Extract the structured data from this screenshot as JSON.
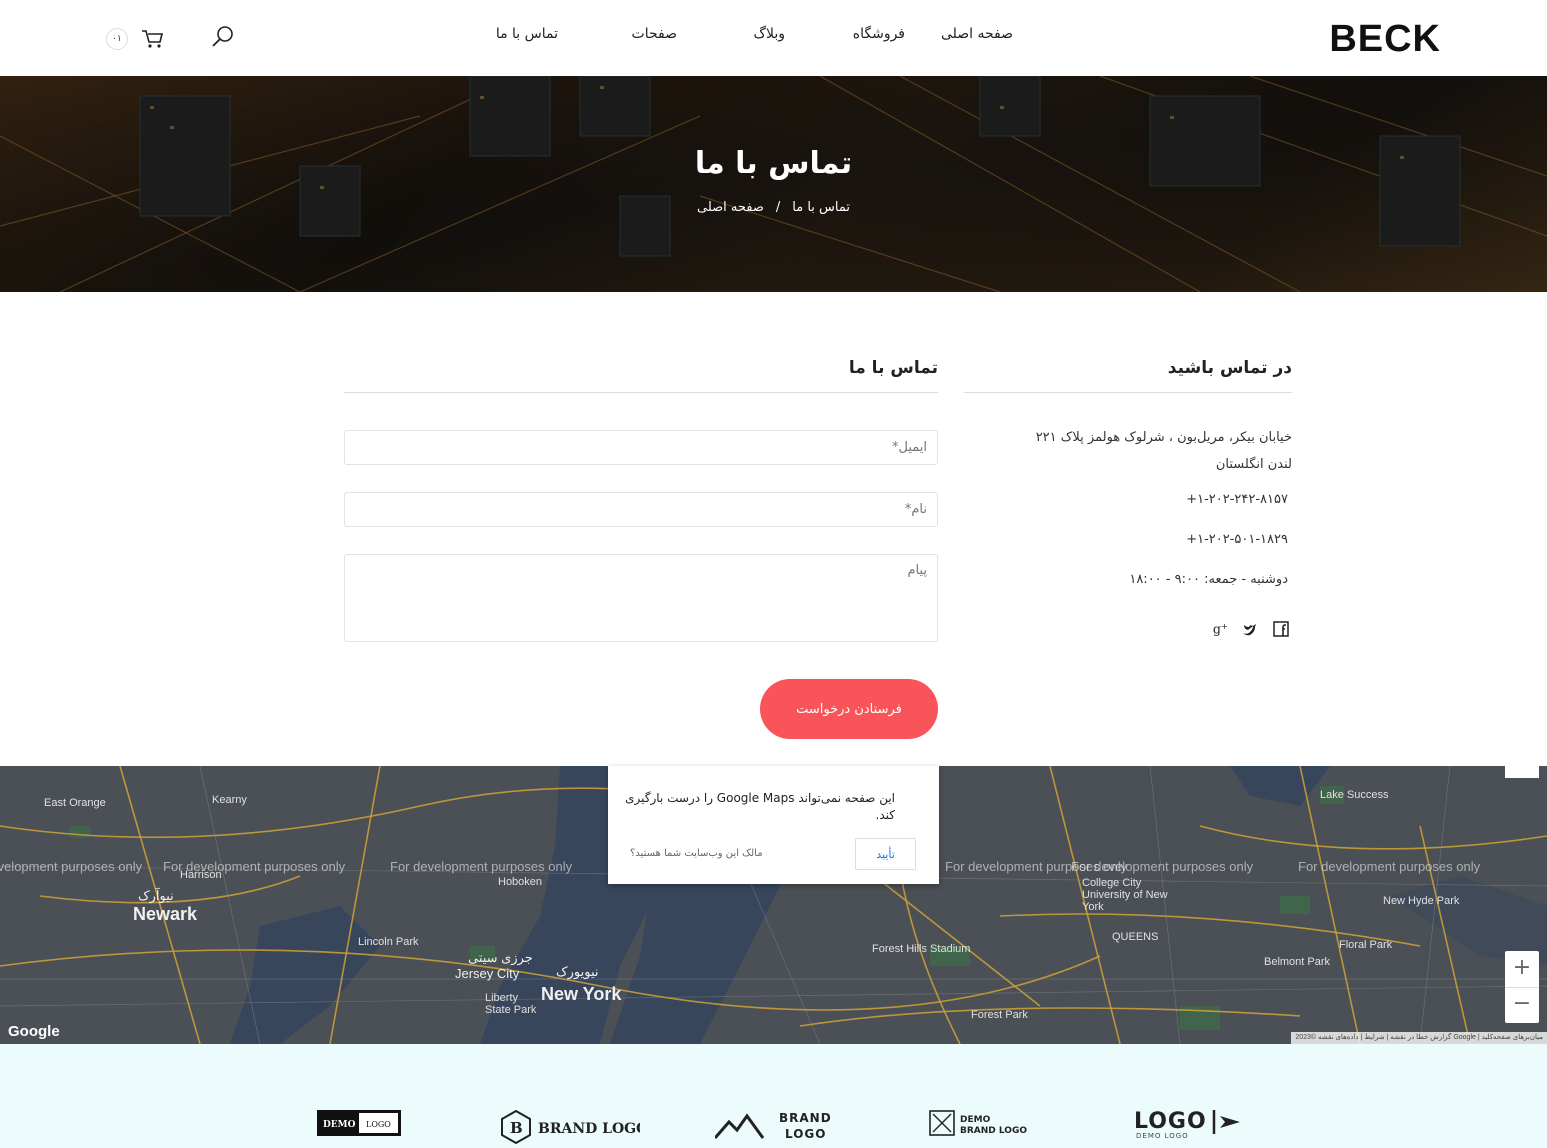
{
  "header": {
    "logo": "BECK",
    "nav": [
      "صفحه اصلی",
      "فروشگاه",
      "وبلاگ",
      "صفحات",
      "تماس با ما"
    ],
    "cart_count": "۰۱"
  },
  "hero": {
    "title": "تماس با ما",
    "breadcrumb": {
      "home": "صفحه اصلی",
      "separator": "/",
      "current": "تماس با ما"
    }
  },
  "contact_info": {
    "title": "در تماس باشید",
    "address_line1": "خیابان بیکر، مریل‌بون ، شرلوک هولمز پلاک ۲۲۱",
    "address_line2": "لندن انگلستان",
    "phone1": "+۱-۲۰۲-۲۴۲-۸۱۵۷",
    "phone2": "+۱-۲۰۲-۵۰۱-۱۸۲۹",
    "hours": "دوشنبه - جمعه: ۹:۰۰ - ۱۸:۰۰",
    "social": [
      "facebook-icon",
      "twitter-icon",
      "google-plus-icon"
    ]
  },
  "contact_form": {
    "title": "تماس با ما",
    "email_placeholder": "ایمیل*",
    "name_placeholder": "نام*",
    "message_placeholder": "پیام",
    "submit_label": "فرستادن درخواست"
  },
  "map": {
    "dev_text": "For development purposes only",
    "google_label": "Google",
    "dialog_message": "این صفحه نمی‌تواند Google Maps را درست بارگیری کند.",
    "dialog_owner": "مالک این وب‌سایت شما هستید؟",
    "dialog_ok": "تأیید",
    "footer": "گزارش خطا در نقشه | شرایط | داده‌های نقشه ©2023 Google | میان‌برهای صفحه‌کلید",
    "labels": {
      "newark": "Newark",
      "newark_fa": "نیوآرک",
      "jersey_city": "Jersey City",
      "jersey_city_fa": "جرزی سیتی",
      "new_york": "New York",
      "new_york_fa": "نیویورک",
      "hoboken": "Hoboken",
      "queens": "QUEENS",
      "floral_park": "Floral Park",
      "east_orange": "East Orange",
      "kearny": "Kearny",
      "harrison": "Harrison",
      "lake_success": "Lake Success",
      "new_hyde_park": "New Hyde Park",
      "belmont_park": "Belmont Park",
      "forest_hills": "Forest Hills Stadium",
      "forest_park": "Forest Park",
      "lincoln_park": "Lincoln Park",
      "liberty_park": "Liberty State Park",
      "college_city": "College City University of New York"
    }
  },
  "brands": [
    "DEMO LOGO",
    "BRAND LOGO",
    "BRAND LOGO",
    "DEMO BRAND LOGO",
    "LOGO"
  ]
}
